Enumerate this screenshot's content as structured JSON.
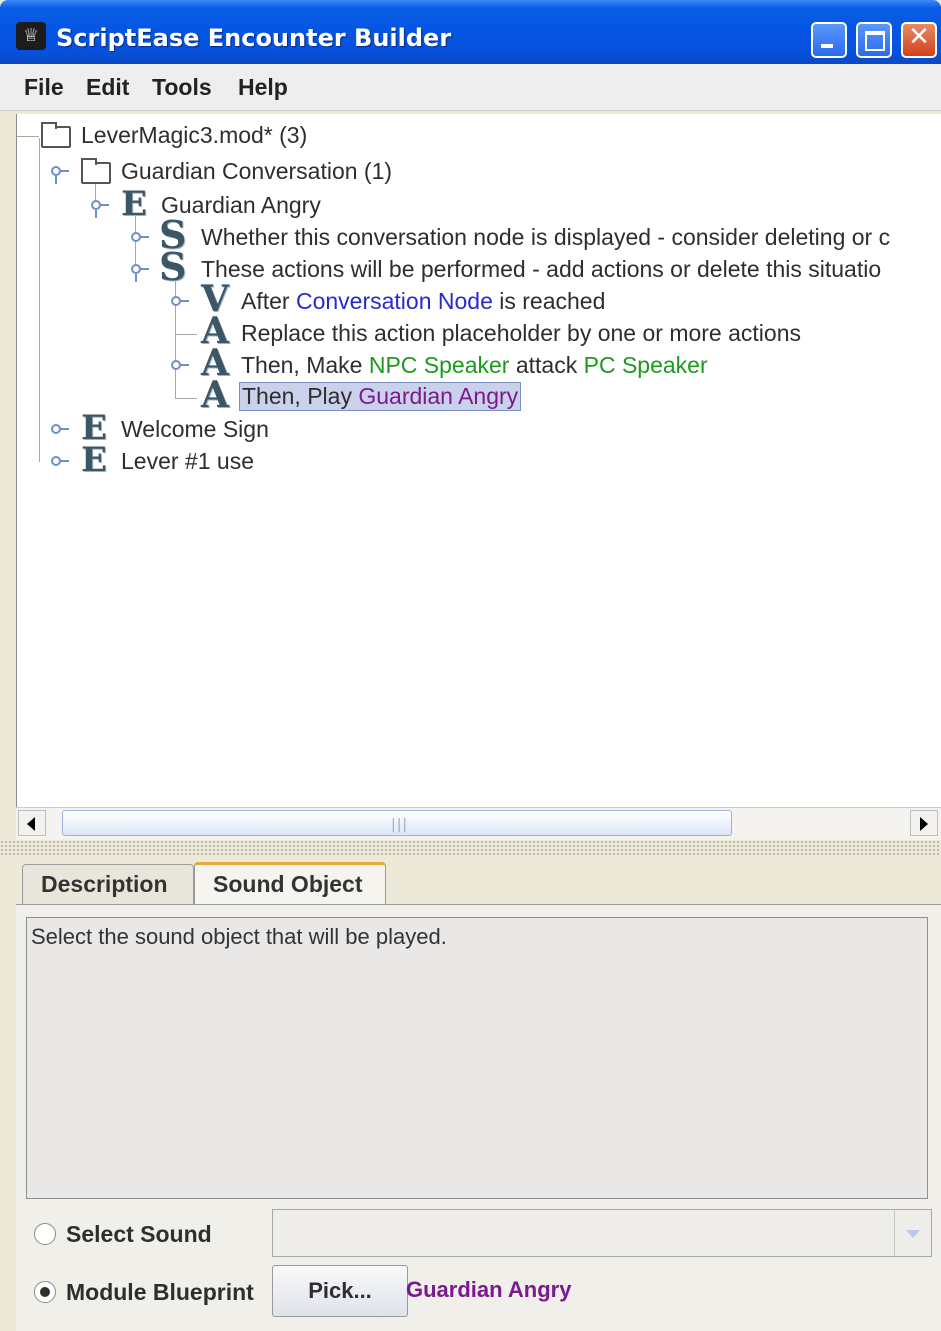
{
  "window": {
    "title": "ScriptEase Encounter Builder"
  },
  "menu": {
    "items": [
      "File",
      "Edit",
      "Tools",
      "Help"
    ]
  },
  "tree": {
    "root": "LeverMagic3.mod* (3)",
    "conversation": "Guardian Conversation (1)",
    "encounter": "Guardian Angry",
    "situation_1": "Whether this conversation node is displayed - consider deleting or c",
    "situation_2": "These actions will be performed - add actions or delete this situatio",
    "event": {
      "prefix": "After ",
      "param": "Conversation Node",
      "suffix": " is reached"
    },
    "action_placeholder": "Replace this action placeholder by one or more actions",
    "action_attack": {
      "prefix": "Then, Make ",
      "param1": "NPC Speaker",
      "middle": " attack ",
      "param2": "PC Speaker"
    },
    "action_play": {
      "prefix": "Then, Play ",
      "param": "Guardian Angry"
    },
    "welcome": "Welcome Sign",
    "lever": "Lever #1 use",
    "icon_letters": {
      "encounter": "E",
      "situation": "S",
      "event": "V",
      "action": "A"
    }
  },
  "tabs": [
    "Description",
    "Sound Object"
  ],
  "sound_panel": {
    "description": "Select the sound object that will be played.",
    "select_sound_label": "Select Sound",
    "select_sound_value": "",
    "module_blueprint_label": "Module Blueprint",
    "pick_button": "Pick...",
    "picked_value": "Guardian Angry",
    "selected_option": "Module Blueprint"
  },
  "colors": {
    "param_blue": "#2a2acc",
    "param_green": "#1b9a1b",
    "param_purple": "#7b1a8e",
    "titlebar": "#0554e3"
  }
}
